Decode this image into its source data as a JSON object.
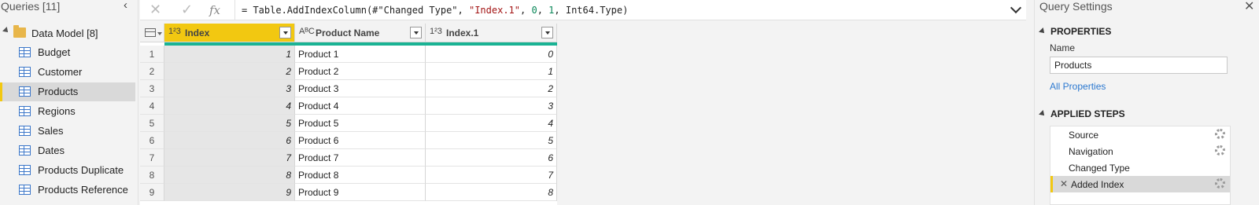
{
  "queries": {
    "header": "Queries [11]",
    "collapse_glyph": "‹",
    "group": {
      "label": "Data Model [8]"
    },
    "items": [
      {
        "label": "Budget",
        "selected": false
      },
      {
        "label": "Customer",
        "selected": false
      },
      {
        "label": "Products",
        "selected": true
      },
      {
        "label": "Regions",
        "selected": false
      },
      {
        "label": "Sales",
        "selected": false
      },
      {
        "label": "Dates",
        "selected": false
      },
      {
        "label": "Products Duplicate",
        "selected": false
      },
      {
        "label": "Products Reference",
        "selected": false
      }
    ]
  },
  "formula_bar": {
    "cancel_glyph": "✕",
    "commit_glyph": "✓",
    "fx_glyph": "fx",
    "formula_parts": [
      {
        "t": "= Table.AddIndexColumn(#\"Changed Type\", ",
        "k": "plain"
      },
      {
        "t": "\"Index.1\"",
        "k": "str"
      },
      {
        "t": ", ",
        "k": "plain"
      },
      {
        "t": "0",
        "k": "num"
      },
      {
        "t": ", ",
        "k": "plain"
      },
      {
        "t": "1",
        "k": "num"
      },
      {
        "t": ", Int64.Type)",
        "k": "plain"
      }
    ]
  },
  "grid": {
    "columns": [
      {
        "name": "Index",
        "type_icon": "1²3",
        "active": true
      },
      {
        "name": "Product Name",
        "type_icon": "AᴮC",
        "active": false
      },
      {
        "name": "Index.1",
        "type_icon": "1²3",
        "active": false
      }
    ],
    "rows": [
      {
        "n": "1",
        "index": "1",
        "product": "Product 1",
        "index1": "0"
      },
      {
        "n": "2",
        "index": "2",
        "product": "Product 2",
        "index1": "1"
      },
      {
        "n": "3",
        "index": "3",
        "product": "Product 3",
        "index1": "2"
      },
      {
        "n": "4",
        "index": "4",
        "product": "Product 4",
        "index1": "3"
      },
      {
        "n": "5",
        "index": "5",
        "product": "Product 5",
        "index1": "4"
      },
      {
        "n": "6",
        "index": "6",
        "product": "Product 6",
        "index1": "5"
      },
      {
        "n": "7",
        "index": "7",
        "product": "Product 7",
        "index1": "6"
      },
      {
        "n": "8",
        "index": "8",
        "product": "Product 8",
        "index1": "7"
      },
      {
        "n": "9",
        "index": "9",
        "product": "Product 9",
        "index1": "8"
      }
    ]
  },
  "settings": {
    "title": "Query Settings",
    "close_glyph": "✕",
    "properties_title": "PROPERTIES",
    "name_label": "Name",
    "name_value": "Products",
    "all_properties": "All Properties",
    "applied_steps_title": "APPLIED STEPS",
    "steps": [
      {
        "label": "Source",
        "gear": true,
        "selected": false,
        "deletable": false
      },
      {
        "label": "Navigation",
        "gear": true,
        "selected": false,
        "deletable": false
      },
      {
        "label": "Changed Type",
        "gear": false,
        "selected": false,
        "deletable": false
      },
      {
        "label": "Added Index",
        "gear": true,
        "selected": true,
        "deletable": true
      }
    ],
    "delete_glyph": "✕"
  },
  "colors": {
    "accent_yellow": "#f2c811",
    "teal_quality": "#1ab394",
    "link_blue": "#2b78d0"
  }
}
